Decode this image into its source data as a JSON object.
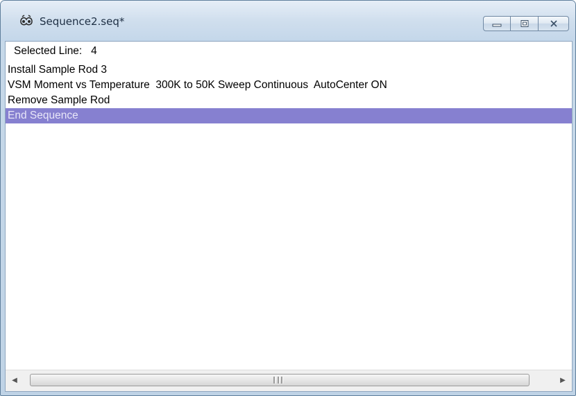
{
  "window": {
    "title": "Sequence2.seq*",
    "icon": "sequence-app-icon",
    "controls": [
      "minimize",
      "maximize",
      "close"
    ]
  },
  "status": {
    "selected_line_label": "Selected Line:",
    "selected_line_value": "4"
  },
  "sequence": {
    "items": [
      "Install Sample Rod 3",
      "VSM Moment vs Temperature  300K to 50K Sweep Continuous  AutoCenter ON",
      "Remove Sample Rod",
      "End Sequence"
    ],
    "selected_index": 3
  },
  "colors": {
    "selection_bg": "#8680d0",
    "selection_text": "#e8e6f8"
  }
}
